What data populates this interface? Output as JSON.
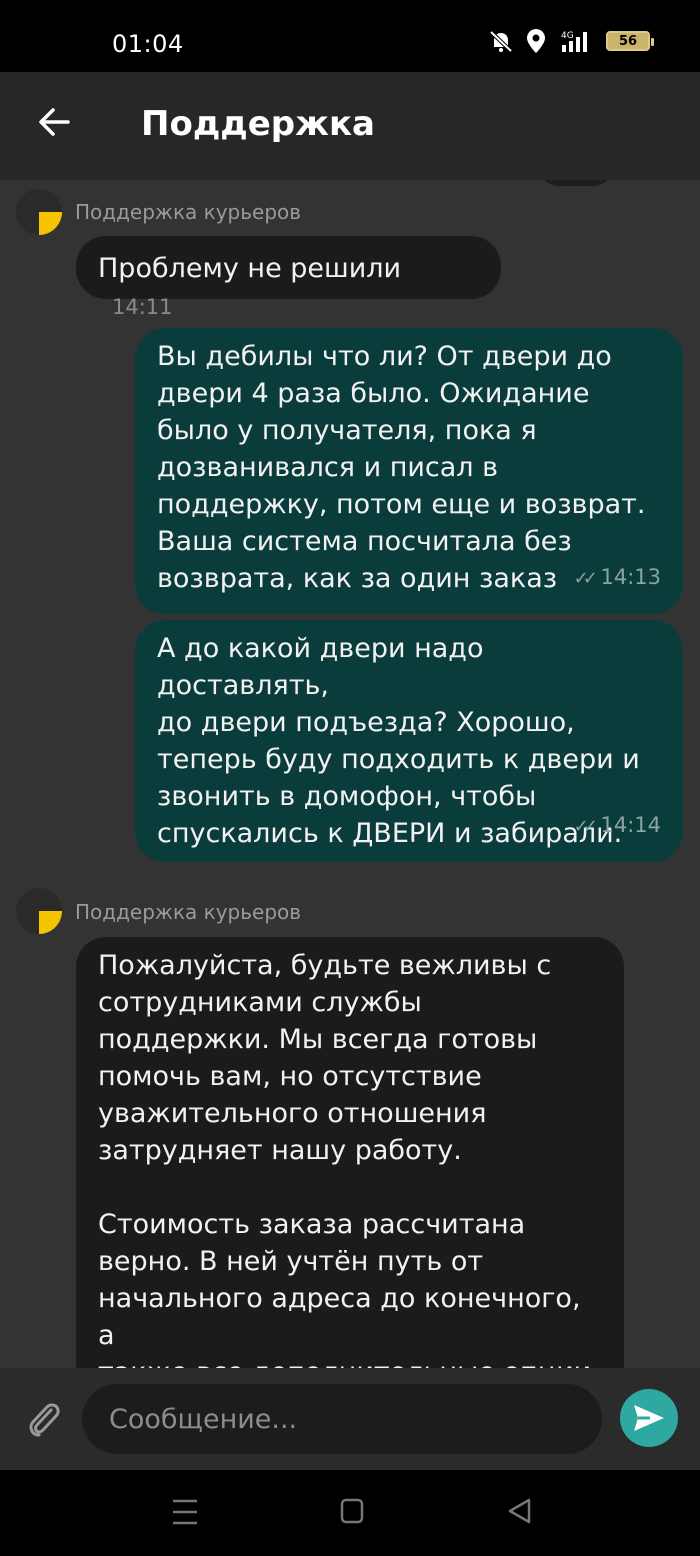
{
  "status_bar": {
    "time": "01:04",
    "battery": "56",
    "network": "4G"
  },
  "header": {
    "title": "Поддержка",
    "back_icon": "arrow-left-icon"
  },
  "messages": [
    {
      "sender": "Поддержка курьеров",
      "text": "Проблему не решили",
      "time": "14:11",
      "direction": "incoming"
    },
    {
      "text": "Вы дебилы что ли? От двери до\nдвери 4 раза было. Ожидание\nбыло у получателя, пока я\nдозванивался и писал в\nподдержку, потом еще и возврат.\nВаша система посчитала без\nвозврата, как за один заказ",
      "time": "14:13",
      "direction": "outgoing",
      "status": "read"
    },
    {
      "text": "А до какой двери надо доставлять,\nдо двери подъезда? Хорошо,\nтеперь буду подходить к двери и\nзвонить в домофон, чтобы\nспускались к ДВЕРИ и забирали.",
      "time": "14:14",
      "direction": "outgoing",
      "status": "read"
    },
    {
      "sender": "Поддержка курьеров",
      "text": "Пожалуйста, будьте вежливы с\nсотрудниками службы\nподдержки. Мы всегда готовы\nпомочь вам, но отсутствие\nуважительного отношения\nзатрудняет нашу работу.\n\nСтоимость заказа рассчитана\nверно. В ней учтён путь от\nначального адреса до конечного, а\nтакже все дополнительные опции,\nуслуги и остановки.",
      "direction": "incoming"
    }
  ],
  "composer": {
    "placeholder": "Сообщение...",
    "attach_icon": "paperclip-icon",
    "send_icon": "send-icon"
  },
  "colors": {
    "incoming_bubble": "#1b1b1b",
    "outgoing_bubble": "#0b3c3c",
    "accent": "#2ea9a1",
    "avatar_yellow": "#f5c400"
  }
}
